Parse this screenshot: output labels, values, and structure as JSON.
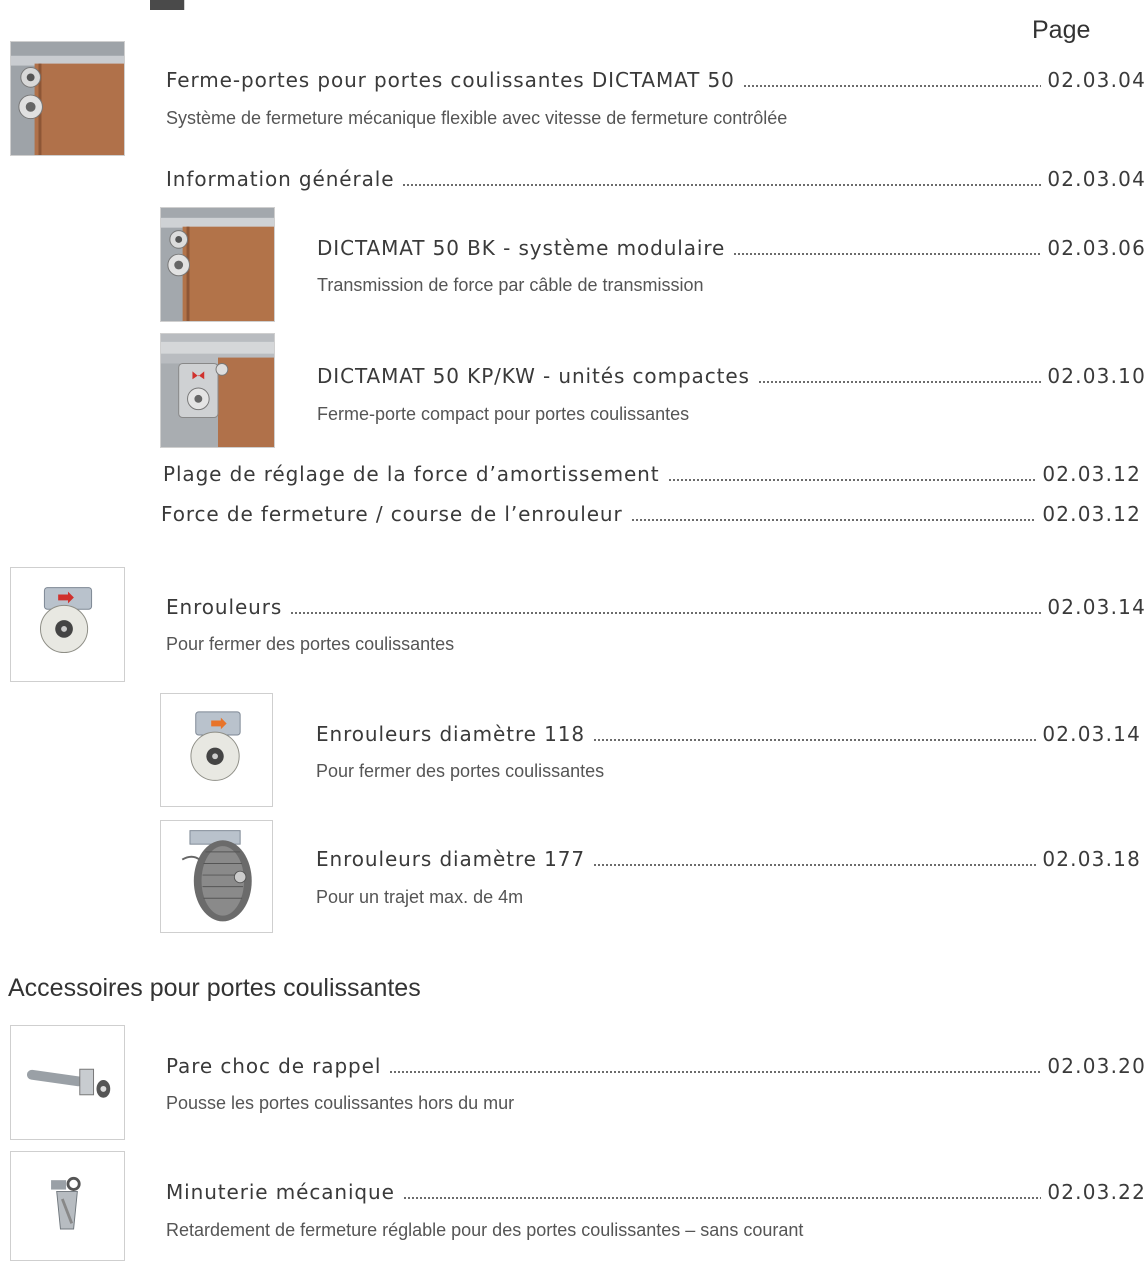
{
  "page_header": {
    "label": "Page"
  },
  "sections": [
    {
      "entries": [
        {
          "title": "Ferme-portes pour portes coulissantes DICTAMAT 50",
          "page": "02.03.04",
          "subtitle": "Système de fermeture mécanique flexible avec vitesse de fermeture contrôlée",
          "icon": "sliding-door-closer-icon"
        },
        {
          "title": "Information générale",
          "page": "02.03.04"
        },
        {
          "title": "DICTAMAT 50 BK - système modulaire",
          "page": "02.03.06",
          "subtitle": "Transmission de force par câble de transmission",
          "icon": "sliding-door-closer-icon"
        },
        {
          "title": "DICTAMAT 50 KP/KW - unités compactes",
          "page": "02.03.10",
          "subtitle": "Ferme-porte compact pour portes coulissantes",
          "icon": "compact-closer-icon"
        },
        {
          "title": "Plage de réglage de la force d’amortissement",
          "page": "02.03.12"
        },
        {
          "title": "Force de fermeture / course de l’enrouleur",
          "page": "02.03.12"
        }
      ]
    },
    {
      "entries": [
        {
          "title": "Enrouleurs",
          "page": "02.03.14",
          "subtitle": "Pour fermer des portes coulissantes",
          "icon": "cable-reel-icon"
        },
        {
          "title": "Enrouleurs diamètre 118",
          "page": "02.03.14",
          "subtitle": "Pour fermer des portes coulissantes",
          "icon": "cable-reel-icon"
        },
        {
          "title": "Enrouleurs diamètre 177",
          "page": "02.03.18",
          "subtitle": "Pour un trajet max. de 4m",
          "icon": "large-cable-reel-icon"
        }
      ]
    },
    {
      "heading": "Accessoires pour portes coulissantes",
      "entries": [
        {
          "title": "Pare choc de rappel",
          "page": "02.03.20",
          "subtitle": "Pousse les portes coulissantes hors du mur",
          "icon": "buffer-stop-icon"
        },
        {
          "title": "Minuterie mécanique",
          "page": "02.03.22",
          "subtitle": "Retardement de fermeture réglable pour des portes coulissantes – sans courant",
          "icon": "mechanical-timer-icon"
        }
      ]
    }
  ]
}
